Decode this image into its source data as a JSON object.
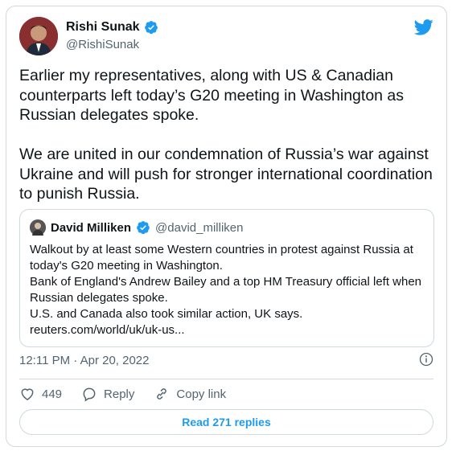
{
  "author": {
    "name": "Rishi Sunak",
    "handle": "@RishiSunak",
    "verified": true
  },
  "tweet": {
    "text": "Earlier my representatives, along with US & Canadian counterparts left today’s G20 meeting in Washington as Russian delegates spoke.\n\nWe are united in our condemnation of Russia’s war against Ukraine and will push for stronger international coordination to punish Russia."
  },
  "quoted": {
    "name": "David Milliken",
    "handle": "@david_milliken",
    "verified": true,
    "text": "Walkout by at least some Western countries in protest against Russia at today's G20 meeting in Washington.\nBank of England's Andrew Bailey and a top HM Treasury official left when Russian delegates spoke.\nU.S. and Canada also took similar action, UK says.\nreuters.com/world/uk/uk-us..."
  },
  "meta": {
    "timestamp": "12:11 PM · Apr 20, 2022"
  },
  "actions": {
    "likes": "449",
    "reply_label": "Reply",
    "copy_label": "Copy link"
  },
  "read_replies_label": "Read 271 replies",
  "colors": {
    "accent": "#1d9bf0",
    "muted": "#536471",
    "border": "#cfd9de"
  },
  "icons": [
    "twitter-bird-icon",
    "verified-badge-icon",
    "info-icon",
    "heart-icon",
    "reply-icon",
    "link-icon"
  ]
}
